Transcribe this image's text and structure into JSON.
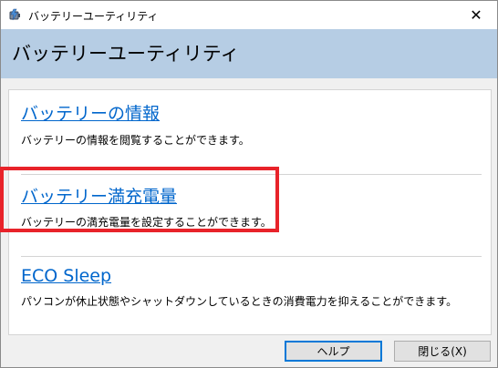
{
  "window": {
    "title": "バッテリーユーティリティ",
    "close_glyph": "✕"
  },
  "header": {
    "title": "バッテリーユーティリティ"
  },
  "items": [
    {
      "label": "バッテリーの情報",
      "description": "バッテリーの情報を閲覧することができます。"
    },
    {
      "label": "バッテリー満充電量",
      "description": "バッテリーの満充電量を設定することができます。"
    },
    {
      "label": "ECO Sleep",
      "description": "パソコンが休止状態やシャットダウンしているときの消費電力を抑えることができます。"
    }
  ],
  "buttons": {
    "help_label": "ヘルプ",
    "close_label": "閉じる(X)"
  },
  "colors": {
    "header_band": "#b6cde4",
    "link": "#0066cc",
    "highlight": "#e8232a"
  },
  "icons": {
    "app": "battery-utility-icon",
    "close": "close-icon"
  }
}
